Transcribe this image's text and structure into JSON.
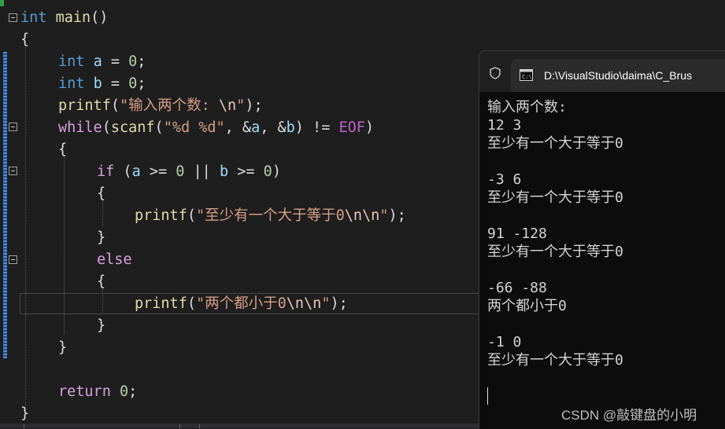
{
  "editor": {
    "lines": {
      "l1": {
        "kw": "int",
        "fn": "main",
        "rest": "()"
      },
      "l2": "{",
      "l3": {
        "kw": "int",
        "var": "a",
        "op": " = ",
        "num": "0",
        "end": ";"
      },
      "l4": {
        "kw": "int",
        "var": "b",
        "op": " = ",
        "num": "0",
        "end": ";"
      },
      "l5": {
        "fn": "printf",
        "open": "(",
        "str": "\"输入两个数: ",
        "esc": "\\n",
        "strend": "\"",
        "close": ");"
      },
      "l6": {
        "ctl": "while",
        "p1": "(",
        "fn": "scanf",
        "p2": "(",
        "str": "\"%d %d\"",
        "p3": ", &",
        "v1": "a",
        "p4": ", &",
        "v2": "b",
        "p5": ") != ",
        "mac": "EOF",
        "p6": ")"
      },
      "l7": "{",
      "l8": {
        "ctl": "if",
        "p1": " (",
        "v1": "a",
        "p2": " >= ",
        "n1": "0",
        "p3": " || ",
        "v2": "b",
        "p4": " >= ",
        "n2": "0",
        "p5": ")"
      },
      "l9": "{",
      "l10": {
        "fn": "printf",
        "open": "(",
        "str": "\"至少有一个大于等于0",
        "esc": "\\n\\n",
        "strend": "\"",
        "close": ");"
      },
      "l11": "}",
      "l12": {
        "ctl": "else"
      },
      "l13": "{",
      "l14": {
        "fn": "printf",
        "open": "(",
        "str": "\"两个都小于0",
        "esc": "\\n\\n",
        "strend": "\"",
        "close": ");"
      },
      "l15": "}",
      "l16": "}",
      "l18": {
        "ctl": "return",
        "sp": " ",
        "num": "0",
        "end": ";"
      },
      "l19": "}"
    }
  },
  "console": {
    "tab_title": "D:\\VisualStudio\\daima\\C_Brus",
    "icons": {
      "shield": "shield-icon",
      "terminal": "terminal-icon"
    },
    "output": [
      "输入两个数:",
      "12 3",
      "至少有一个大于等于0",
      "",
      "-3 6",
      "至少有一个大于等于0",
      "",
      "91 -128",
      "至少有一个大于等于0",
      "",
      "-66 -88",
      "两个都小于0",
      "",
      "-1 0",
      "至少有一个大于等于0"
    ]
  },
  "watermark": "CSDN @敲键盘的小明",
  "colors": {
    "keyword": "#569cd6",
    "control": "#d8a0df",
    "function": "#dcdcaa",
    "variable": "#9cdcfe",
    "number": "#b5cea8",
    "string": "#d69d85",
    "macro": "#bd63c5",
    "background": "#1e1e1e",
    "console_bg": "#0c0c0c"
  }
}
